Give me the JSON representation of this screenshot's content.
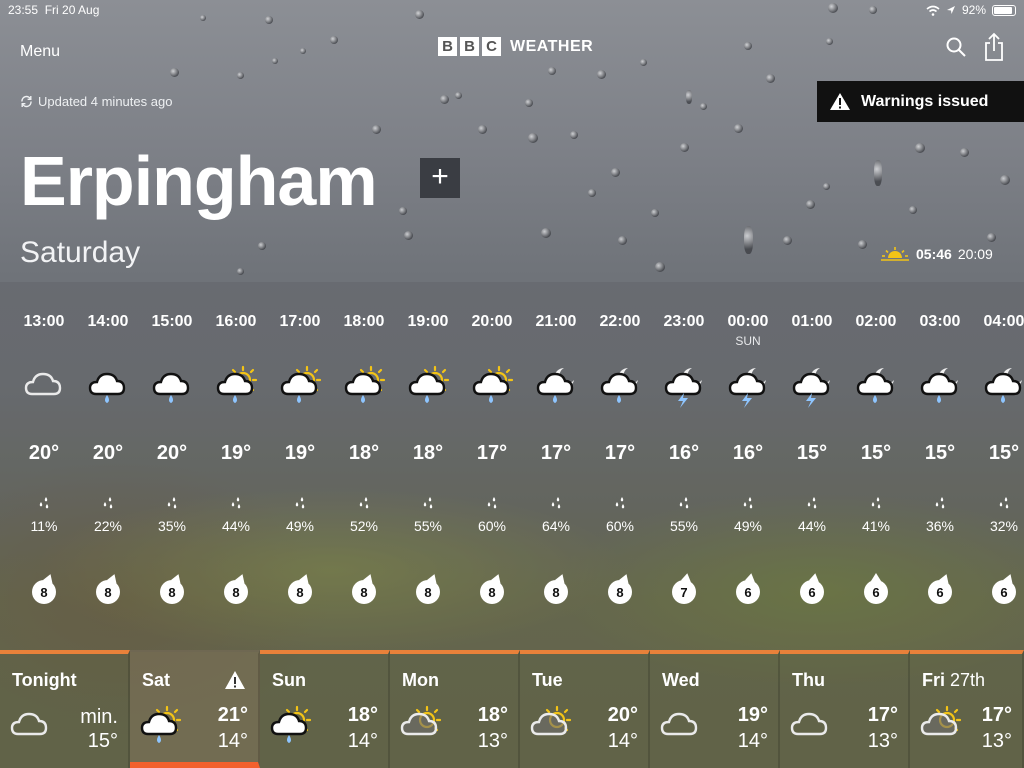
{
  "status_bar": {
    "time": "23:55",
    "date": "Fri 20 Aug",
    "battery": "92%",
    "battery_level": 0.92
  },
  "header": {
    "menu_label": "Menu",
    "brand_letters": [
      "B",
      "B",
      "C"
    ],
    "brand_word": "WEATHER"
  },
  "updated_text": "Updated 4 minutes ago",
  "warning": {
    "label": "Warnings issued"
  },
  "location": {
    "name": "Erpingham",
    "add_label": "+"
  },
  "day_label": "Saturday",
  "sun": {
    "sunrise": "05:46",
    "sunset": "20:09"
  },
  "hourly": [
    {
      "time": "13:00",
      "day": "",
      "icon": "cloud-icon",
      "temp": "20°",
      "rain": "11%",
      "wind": "8",
      "wind_dir": 20
    },
    {
      "time": "14:00",
      "day": "",
      "icon": "cloud-rain-icon",
      "temp": "20°",
      "rain": "22%",
      "wind": "8",
      "wind_dir": 20
    },
    {
      "time": "15:00",
      "day": "",
      "icon": "cloud-rain-icon",
      "temp": "20°",
      "rain": "35%",
      "wind": "8",
      "wind_dir": 20
    },
    {
      "time": "16:00",
      "day": "",
      "icon": "sun-cloud-rain-icon",
      "temp": "19°",
      "rain": "44%",
      "wind": "8",
      "wind_dir": 20
    },
    {
      "time": "17:00",
      "day": "",
      "icon": "sun-cloud-rain-icon",
      "temp": "19°",
      "rain": "49%",
      "wind": "8",
      "wind_dir": 20
    },
    {
      "time": "18:00",
      "day": "",
      "icon": "sun-cloud-rain-icon",
      "temp": "18°",
      "rain": "52%",
      "wind": "8",
      "wind_dir": 20
    },
    {
      "time": "19:00",
      "day": "",
      "icon": "sun-cloud-rain-icon",
      "temp": "18°",
      "rain": "55%",
      "wind": "8",
      "wind_dir": 20
    },
    {
      "time": "20:00",
      "day": "",
      "icon": "sun-cloud-rain-icon",
      "temp": "17°",
      "rain": "60%",
      "wind": "8",
      "wind_dir": 20
    },
    {
      "time": "21:00",
      "day": "",
      "icon": "moon-cloud-rain-icon",
      "temp": "17°",
      "rain": "64%",
      "wind": "8",
      "wind_dir": 20
    },
    {
      "time": "22:00",
      "day": "",
      "icon": "moon-cloud-rain-icon",
      "temp": "17°",
      "rain": "60%",
      "wind": "8",
      "wind_dir": 20
    },
    {
      "time": "23:00",
      "day": "",
      "icon": "moon-cloud-thunder-icon",
      "temp": "16°",
      "rain": "55%",
      "wind": "7",
      "wind_dir": 10
    },
    {
      "time": "00:00",
      "day": "SUN",
      "icon": "moon-cloud-thunder-icon",
      "temp": "16°",
      "rain": "49%",
      "wind": "6",
      "wind_dir": 10
    },
    {
      "time": "01:00",
      "day": "",
      "icon": "moon-cloud-thunder-icon",
      "temp": "15°",
      "rain": "44%",
      "wind": "6",
      "wind_dir": 10
    },
    {
      "time": "02:00",
      "day": "",
      "icon": "moon-cloud-rain-icon",
      "temp": "15°",
      "rain": "41%",
      "wind": "6",
      "wind_dir": 0
    },
    {
      "time": "03:00",
      "day": "",
      "icon": "moon-cloud-rain-icon",
      "temp": "15°",
      "rain": "36%",
      "wind": "6",
      "wind_dir": 20
    },
    {
      "time": "04:00",
      "day": "",
      "icon": "moon-cloud-rain-icon",
      "temp": "15°",
      "rain": "32%",
      "wind": "6",
      "wind_dir": 20
    }
  ],
  "daily": [
    {
      "name": "Tonight",
      "sub": "",
      "icon": "cloud-icon",
      "hi": "",
      "min_label": "min.",
      "lo": "15°",
      "warning": false,
      "selected": false
    },
    {
      "name": "Sat",
      "sub": "",
      "icon": "sun-cloud-rain-icon",
      "hi": "21°",
      "min_label": "",
      "lo": "14°",
      "warning": true,
      "selected": true
    },
    {
      "name": "Sun",
      "sub": "",
      "icon": "sun-cloud-rain-icon",
      "hi": "18°",
      "min_label": "",
      "lo": "14°",
      "warning": false,
      "selected": false
    },
    {
      "name": "Mon",
      "sub": "",
      "icon": "sun-cloud-icon",
      "hi": "18°",
      "min_label": "",
      "lo": "13°",
      "warning": false,
      "selected": false
    },
    {
      "name": "Tue",
      "sub": "",
      "icon": "sun-cloud-icon",
      "hi": "20°",
      "min_label": "",
      "lo": "14°",
      "warning": false,
      "selected": false
    },
    {
      "name": "Wed",
      "sub": "",
      "icon": "cloud-icon",
      "hi": "19°",
      "min_label": "",
      "lo": "14°",
      "warning": false,
      "selected": false
    },
    {
      "name": "Thu",
      "sub": "",
      "icon": "cloud-icon",
      "hi": "17°",
      "min_label": "",
      "lo": "13°",
      "warning": false,
      "selected": false
    },
    {
      "name": "Fri",
      "sub": "27th",
      "icon": "sun-cloud-icon",
      "hi": "17°",
      "min_label": "",
      "lo": "13°",
      "warning": false,
      "selected": false
    }
  ],
  "colors": {
    "sun": "#f3c416",
    "rain_drop": "#8ec5ff",
    "lightning": "#8ec5ff",
    "day_accent": "#e8813a",
    "selected_accent": "#f2602d",
    "warning_bg": "#111111"
  }
}
